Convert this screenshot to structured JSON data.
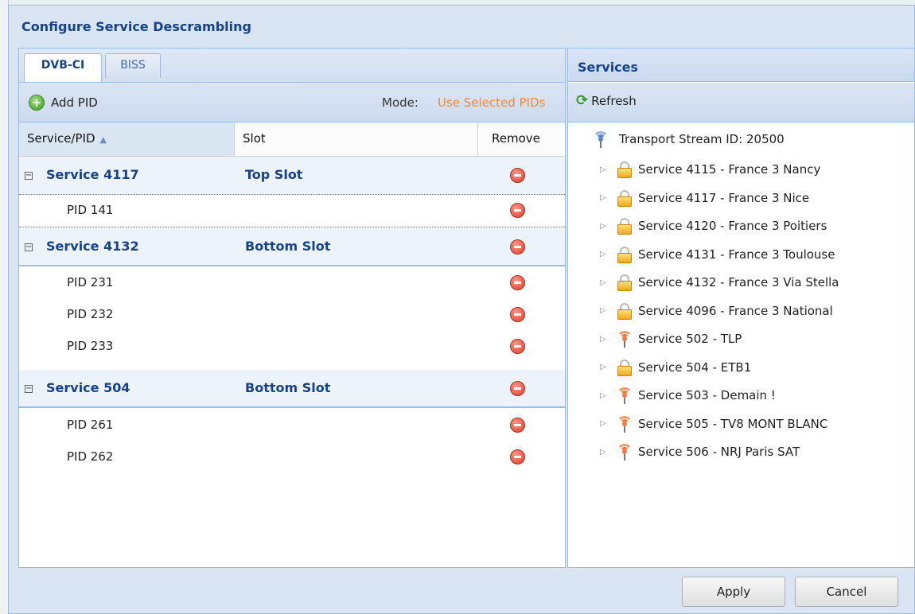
{
  "window": {
    "title": "Configure Service Descrambling"
  },
  "tabs": [
    {
      "label": "DVB-CI",
      "active": true
    },
    {
      "label": "BISS",
      "active": false
    }
  ],
  "toolbar": {
    "add_pid": "Add PID",
    "mode_label": "Mode:",
    "mode_value": "Use Selected PIDs"
  },
  "grid": {
    "headers": {
      "service_pid": "Service/PID",
      "slot": "Slot",
      "remove": "Remove"
    },
    "groups": [
      {
        "name": "Service 4117",
        "slot": "Top Slot",
        "pids": [
          "PID 141"
        ]
      },
      {
        "name": "Service 4132",
        "slot": "Bottom Slot",
        "pids": [
          "PID 231",
          "PID 232",
          "PID 233"
        ]
      },
      {
        "name": "Service 504",
        "slot": "Bottom Slot",
        "pids": [
          "PID 261",
          "PID 262"
        ]
      }
    ]
  },
  "services_panel": {
    "title": "Services",
    "refresh": "Refresh",
    "root": "Transport Stream ID: 20500",
    "items": [
      {
        "label": "Service 4115 - France 3 Nancy",
        "icon": "lock-icon"
      },
      {
        "label": "Service 4117 - France 3 Nice",
        "icon": "lock-icon"
      },
      {
        "label": "Service 4120 - France 3 Poitiers",
        "icon": "lock-icon"
      },
      {
        "label": "Service 4131 - France 3 Toulouse",
        "icon": "lock-icon"
      },
      {
        "label": "Service 4132 - France 3 Via Stella",
        "icon": "lock-icon"
      },
      {
        "label": "Service 4096 - France 3 National",
        "icon": "lock-icon"
      },
      {
        "label": "Service 502 - TLP",
        "icon": "signal-icon"
      },
      {
        "label": "Service 504 - ETB1",
        "icon": "lock-icon"
      },
      {
        "label": "Service 503 - Demain !",
        "icon": "signal-icon"
      },
      {
        "label": "Service 505 - TV8 MONT BLANC",
        "icon": "signal-icon"
      },
      {
        "label": "Service 506 - NRJ Paris SAT",
        "icon": "signal-icon"
      }
    ]
  },
  "buttons": {
    "apply": "Apply",
    "cancel": "Cancel"
  },
  "colors": {
    "header_text": "#15428b",
    "mode_value": "#f08a38",
    "border": "#99bbe8"
  }
}
